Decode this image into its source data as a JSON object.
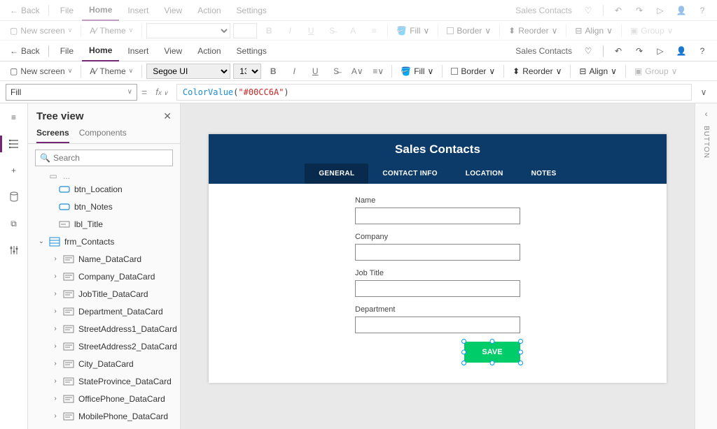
{
  "topbar": {
    "back": "Back",
    "menus": [
      "File",
      "Home",
      "Insert",
      "View",
      "Action",
      "Settings"
    ],
    "active_menu": "Home",
    "app_title": "Sales Contacts"
  },
  "ribbon": {
    "new_screen": "New screen",
    "theme": "Theme",
    "font_family": "Segoe UI",
    "font_size": "13",
    "fill": "Fill",
    "border": "Border",
    "reorder": "Reorder",
    "align": "Align",
    "group": "Group",
    "fill_color": "#00CC6A"
  },
  "formula": {
    "property": "Fill",
    "fn": "ColorValue",
    "arg": "\"#00CC6A\""
  },
  "tree": {
    "title": "Tree view",
    "tabs": [
      "Screens",
      "Components"
    ],
    "active_tab": "Screens",
    "search_placeholder": "Search",
    "items": [
      {
        "label": "btn_Location",
        "icon": "button",
        "level": 0
      },
      {
        "label": "btn_Notes",
        "icon": "button",
        "level": 0
      },
      {
        "label": "lbl_Title",
        "icon": "label",
        "level": 0
      },
      {
        "label": "frm_Contacts",
        "icon": "form",
        "level": -1,
        "expanded": true
      },
      {
        "label": "Name_DataCard",
        "icon": "card",
        "level": 1,
        "caret": true
      },
      {
        "label": "Company_DataCard",
        "icon": "card",
        "level": 1,
        "caret": true
      },
      {
        "label": "JobTitle_DataCard",
        "icon": "card",
        "level": 1,
        "caret": true
      },
      {
        "label": "Department_DataCard",
        "icon": "card",
        "level": 1,
        "caret": true
      },
      {
        "label": "StreetAddress1_DataCard",
        "icon": "card",
        "level": 1,
        "caret": true
      },
      {
        "label": "StreetAddress2_DataCard",
        "icon": "card",
        "level": 1,
        "caret": true
      },
      {
        "label": "City_DataCard",
        "icon": "card",
        "level": 1,
        "caret": true
      },
      {
        "label": "StateProvince_DataCard",
        "icon": "card",
        "level": 1,
        "caret": true
      },
      {
        "label": "OfficePhone_DataCard",
        "icon": "card",
        "level": 1,
        "caret": true
      },
      {
        "label": "MobilePhone_DataCard",
        "icon": "card",
        "level": 1,
        "caret": true
      }
    ]
  },
  "preview": {
    "title": "Sales Contacts",
    "tabs": [
      "GENERAL",
      "CONTACT INFO",
      "LOCATION",
      "NOTES"
    ],
    "active_tab": "GENERAL",
    "fields": [
      "Name",
      "Company",
      "Job Title",
      "Department"
    ],
    "save": "SAVE"
  },
  "right_rail": {
    "label": "BUTTON"
  }
}
